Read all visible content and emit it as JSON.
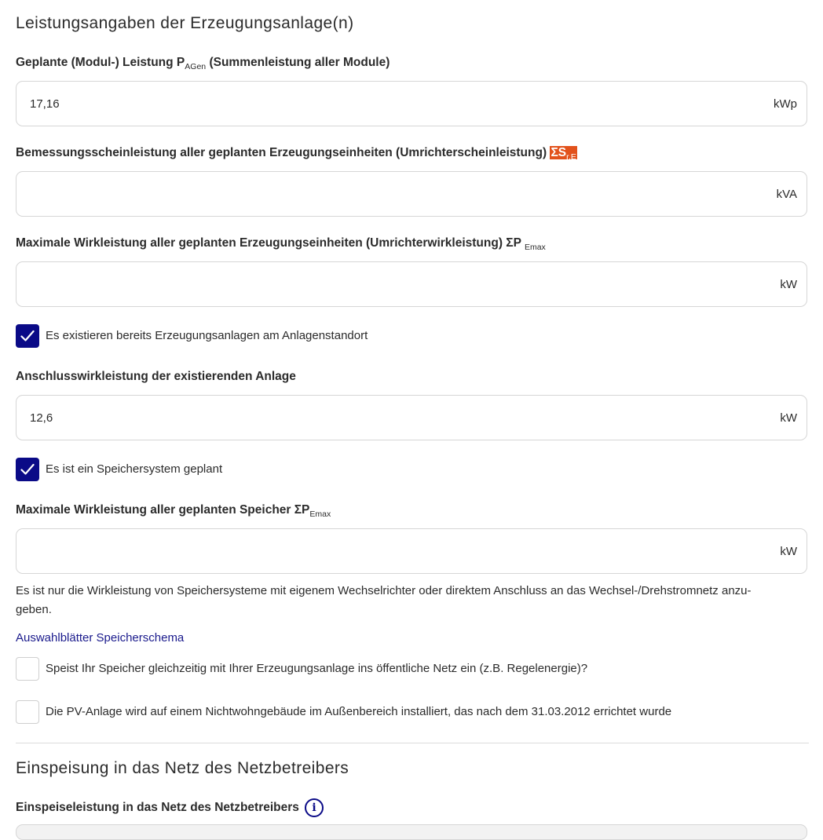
{
  "section1": {
    "title": "Leistungsangaben der Erzeugungsanlage(n)"
  },
  "field_pagen": {
    "label_prefix": "Geplante (Modul-) Leistung P",
    "label_sub": "AGen",
    "label_suffix": " (Summenleistung aller Module)",
    "value": "17,16",
    "unit": "kWp"
  },
  "field_sre": {
    "label_prefix": "Bemessungsscheinleistung aller geplanten Erzeugungseinheiten (Umrichterscheinleistung) ",
    "label_hl": "ΣS",
    "label_sub": "r,E",
    "value": "",
    "unit": "kVA"
  },
  "field_pemax": {
    "label_prefix": "Maximale Wirkleistung aller geplanten Erzeugungseinheiten (Umrichterwirkleistung) ΣP ",
    "label_sub": "Emax",
    "value": "",
    "unit": "kW"
  },
  "checkbox_existing": {
    "label": "Es existieren bereits Erzeugungsanlagen am Anlagenstandort",
    "checked": true
  },
  "field_existing": {
    "label": "Anschlusswirkleistung der existierenden Anlage",
    "value": "12,6",
    "unit": "kW"
  },
  "checkbox_storage": {
    "label": "Es ist ein Speichersystem geplant",
    "checked": true
  },
  "field_storage": {
    "label_prefix": "Maximale Wirkleistung aller geplanten Speicher ΣP",
    "label_sub": "Emax",
    "value": "",
    "unit": "kW"
  },
  "storage_hint": "Es ist nur die Wirkleistung von Speichersysteme mit eigenem Wechselrichter oder direktem Anschluss an das Wechsel-/Drehstromnetz anzu-geben.",
  "storage_hint_line1": "Es ist nur die Wirkleistung von Speichersysteme mit eigenem Wechselrichter oder direktem Anschluss an das Wechsel-/Drehstromnetz anzu-",
  "storage_hint_line2": "geben.",
  "storage_link": "Auswahlblätter Speicherschema",
  "checkbox_feedin": {
    "label": "Speist Ihr Speicher gleichzeitig mit Ihrer Erzeugungsanlage ins öffentliche Netz ein (z.B. Regelenergie)?",
    "checked": false
  },
  "checkbox_outdoor": {
    "label": "Die PV-Anlage wird auf einem Nichtwohngebäude im Außenbereich installiert, das nach dem 31.03.2012 errichtet wurde",
    "checked": false
  },
  "section2": {
    "title": "Einspeisung in das Netz des Netzbetreibers"
  },
  "field_feedin_power": {
    "label": "Einspeiseleistung in das Netz des Netzbetreibers",
    "info_icon": "info-icon"
  },
  "colors": {
    "accent": "#0a0a87",
    "highlight": "#e2521c",
    "border": "#d6d6d6"
  }
}
